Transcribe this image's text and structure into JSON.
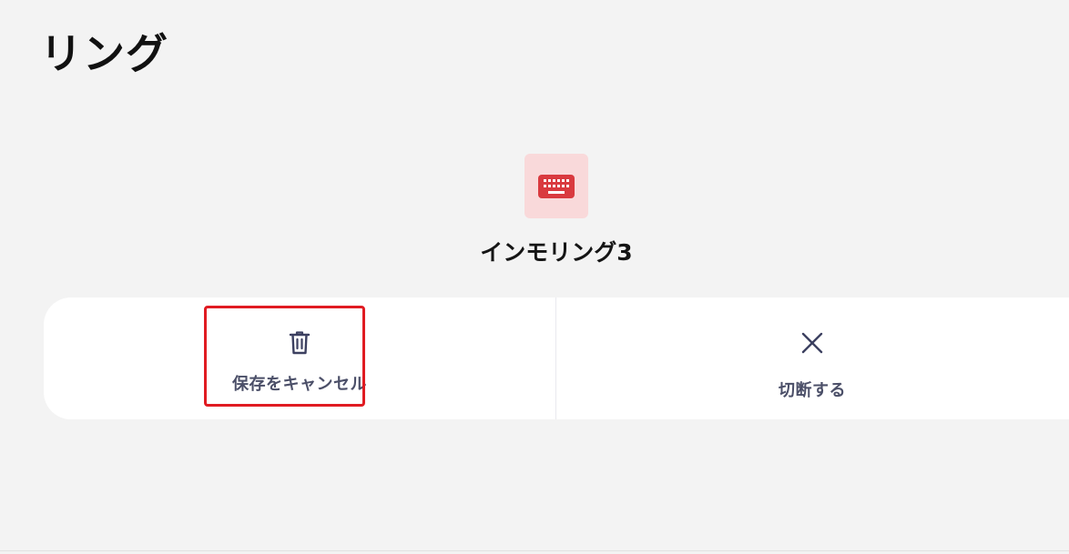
{
  "page": {
    "title": "リング"
  },
  "device": {
    "icon": "keyboard-icon",
    "icon_color": "#d93a3f",
    "icon_bg": "#f9d9da",
    "name": "インモリング3"
  },
  "actions": [
    {
      "icon": "trash-icon",
      "label": "保存をキャンセル",
      "highlighted": true
    },
    {
      "icon": "close-icon",
      "label": "切断する",
      "highlighted": false
    }
  ],
  "colors": {
    "background": "#f3f3f3",
    "panel": "#ffffff",
    "action_text": "#4b4f68",
    "highlight": "#e01b22"
  }
}
